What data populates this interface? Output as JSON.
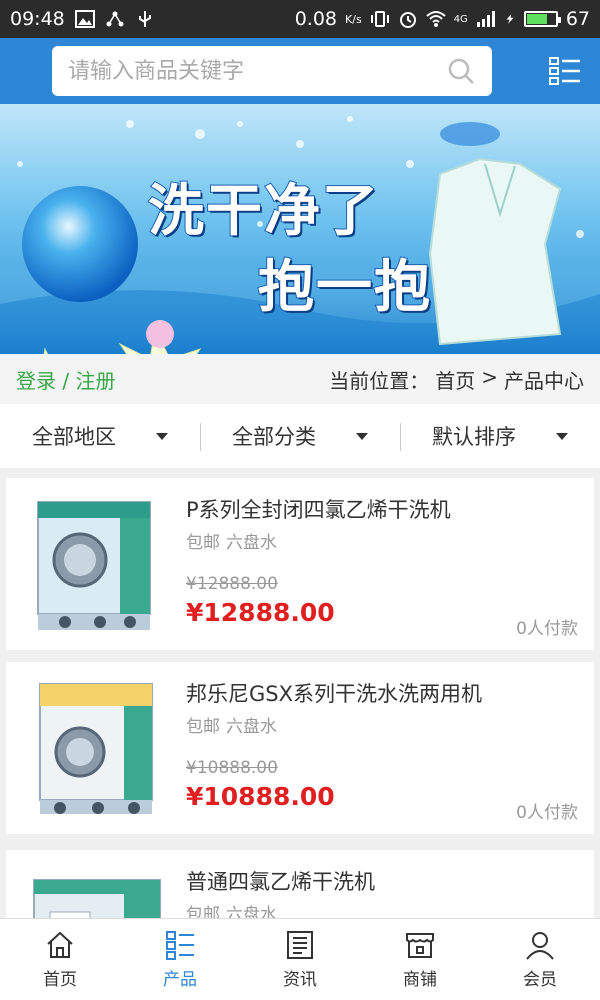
{
  "status_bar": {
    "time": "09:48",
    "speed": "0.08",
    "speed_unit": "K/s",
    "network": "4G",
    "battery_level": "67",
    "battery_fraction": 0.67
  },
  "search": {
    "placeholder": "请输入商品关键字"
  },
  "banner": {
    "line1": "洗干净了",
    "line2": "抱一抱"
  },
  "auth": {
    "login": "登录",
    "separator": "/",
    "register": "注册"
  },
  "breadcrumb": {
    "prefix": "当前位置：",
    "home": "首页",
    "separator": ">",
    "current": "产品中心"
  },
  "filters": [
    {
      "label": "全部地区"
    },
    {
      "label": "全部分类"
    },
    {
      "label": "默认排序"
    }
  ],
  "products": [
    {
      "title": "P系列全封闭四氯乙烯干洗机",
      "shipping": "包邮",
      "location": "六盘水",
      "old_price": "¥12888.00",
      "price": "¥12888.00",
      "sold": "0人付款"
    },
    {
      "title": "邦乐尼GSX系列干洗水洗两用机",
      "shipping": "包邮",
      "location": "六盘水",
      "old_price": "¥10888.00",
      "price": "¥10888.00",
      "sold": "0人付款"
    },
    {
      "title": "普通四氯乙烯干洗机",
      "shipping": "包邮",
      "location": "六盘水",
      "old_price": "",
      "price": "",
      "sold": ""
    }
  ],
  "tabs": [
    {
      "label": "首页",
      "icon": "home-icon"
    },
    {
      "label": "产品",
      "icon": "product-list-icon"
    },
    {
      "label": "资讯",
      "icon": "news-icon"
    },
    {
      "label": "商铺",
      "icon": "store-icon"
    },
    {
      "label": "会员",
      "icon": "member-icon"
    }
  ],
  "colors": {
    "header_blue": "#2e86d6",
    "active_tab": "#2e86d6",
    "price_red": "#e02020",
    "auth_green": "#3aa64a"
  }
}
